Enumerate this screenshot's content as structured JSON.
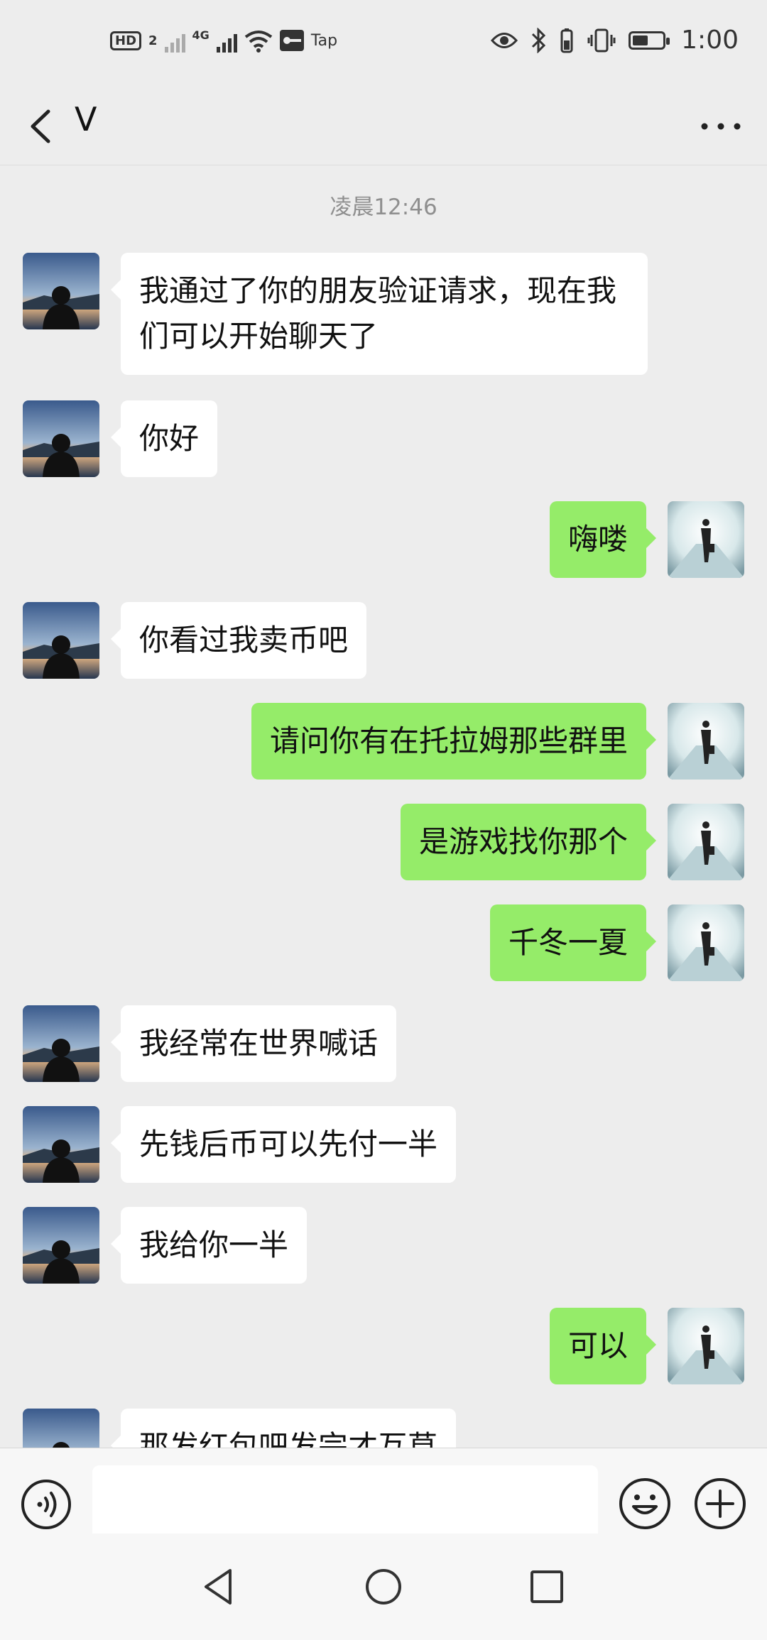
{
  "status_bar": {
    "hd_label": "HD",
    "hd_sub": "2",
    "net_label": "4G",
    "vpn_label": "Tap",
    "time": "1:00"
  },
  "header": {
    "title": "V",
    "back_icon": "chevron-left-icon",
    "more_icon": "more-icon"
  },
  "chat": {
    "timestamp": "凌晨12:46",
    "messages": [
      {
        "side": "in",
        "text": "我通过了你的朋友验证请求，现在我们可以开始聊天了"
      },
      {
        "side": "in",
        "text": "你好"
      },
      {
        "side": "out",
        "text": "嗨喽"
      },
      {
        "side": "in",
        "text": "你看过我卖币吧"
      },
      {
        "side": "out",
        "text": "请问你有在托拉姆那些群里"
      },
      {
        "side": "out",
        "text": "是游戏找你那个"
      },
      {
        "side": "out",
        "text": "千冬一夏"
      },
      {
        "side": "in",
        "text": "我经常在世界喊话"
      },
      {
        "side": "in",
        "text": "先钱后币可以先付一半"
      },
      {
        "side": "in",
        "text": "我给你一半"
      },
      {
        "side": "out",
        "text": "可以"
      },
      {
        "side": "in",
        "text": "那发红包吧发完才互草"
      }
    ]
  },
  "input_bar": {
    "voice_icon": "voice-icon",
    "text_value": "",
    "emoji_icon": "emoji-icon",
    "plus_icon": "plus-icon"
  },
  "nav_bar": {
    "back_icon": "triangle-back-icon",
    "home_icon": "circle-home-icon",
    "recent_icon": "square-recent-icon"
  },
  "colors": {
    "background": "#ededed",
    "incoming_bubble": "#ffffff",
    "outgoing_bubble": "#95ec69"
  }
}
